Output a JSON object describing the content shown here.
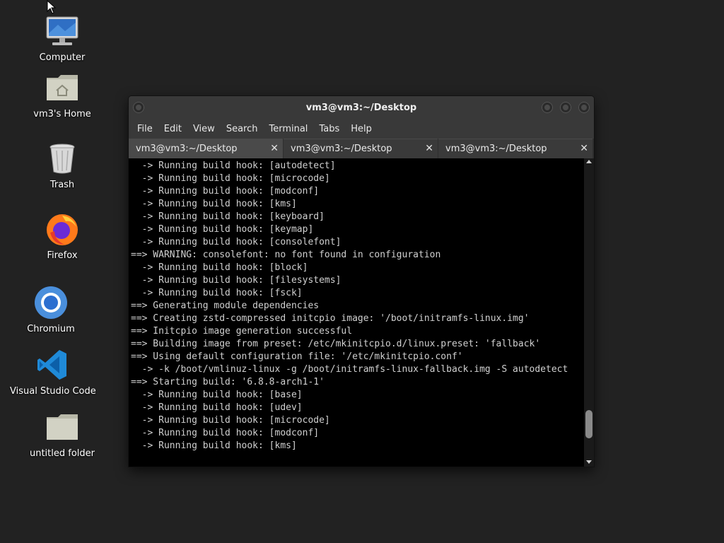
{
  "desktop": {
    "icons": [
      {
        "label": "Computer"
      },
      {
        "label": "vm3's Home"
      },
      {
        "label": "Trash"
      },
      {
        "label": "Firefox"
      },
      {
        "label": "Chromium"
      },
      {
        "label": "Visual Studio Code"
      },
      {
        "label": "untitled folder"
      }
    ]
  },
  "window": {
    "title": "vm3@vm3:~/Desktop",
    "menu": [
      "File",
      "Edit",
      "View",
      "Search",
      "Terminal",
      "Tabs",
      "Help"
    ],
    "tabs": [
      {
        "label": "vm3@vm3:~/Desktop",
        "active": true
      },
      {
        "label": "vm3@vm3:~/Desktop",
        "active": false
      },
      {
        "label": "vm3@vm3:~/Desktop",
        "active": false
      }
    ],
    "tab_close_glyph": "✕"
  },
  "terminal": {
    "lines": [
      "  -> Running build hook: [autodetect]",
      "  -> Running build hook: [microcode]",
      "  -> Running build hook: [modconf]",
      "  -> Running build hook: [kms]",
      "  -> Running build hook: [keyboard]",
      "  -> Running build hook: [keymap]",
      "  -> Running build hook: [consolefont]",
      "==> WARNING: consolefont: no font found in configuration",
      "  -> Running build hook: [block]",
      "  -> Running build hook: [filesystems]",
      "  -> Running build hook: [fsck]",
      "==> Generating module dependencies",
      "==> Creating zstd-compressed initcpio image: '/boot/initramfs-linux.img'",
      "==> Initcpio image generation successful",
      "==> Building image from preset: /etc/mkinitcpio.d/linux.preset: 'fallback'",
      "==> Using default configuration file: '/etc/mkinitcpio.conf'",
      "  -> -k /boot/vmlinuz-linux -g /boot/initramfs-linux-fallback.img -S autodetect",
      "==> Starting build: '6.8.8-arch1-1'",
      "  -> Running build hook: [base]",
      "  -> Running build hook: [udev]",
      "  -> Running build hook: [microcode]",
      "  -> Running build hook: [modconf]",
      "  -> Running build hook: [kms]"
    ],
    "scroll_position_fraction": 0.92
  },
  "colors": {
    "desktop_bg": "#222222",
    "terminal_bg": "#000000",
    "terminal_fg": "#d0d0d0"
  }
}
